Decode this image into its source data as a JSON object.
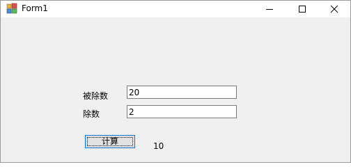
{
  "window": {
    "title": "Form1"
  },
  "form": {
    "dividend_label": "被除数",
    "dividend_value": "20",
    "divisor_label": "除数",
    "divisor_value": "2",
    "calc_button_label": "计算",
    "result_text": "10"
  },
  "icons": {
    "app": "winforms-app-icon",
    "minimize": "minimize-icon",
    "maximize": "maximize-icon",
    "close": "close-icon"
  }
}
